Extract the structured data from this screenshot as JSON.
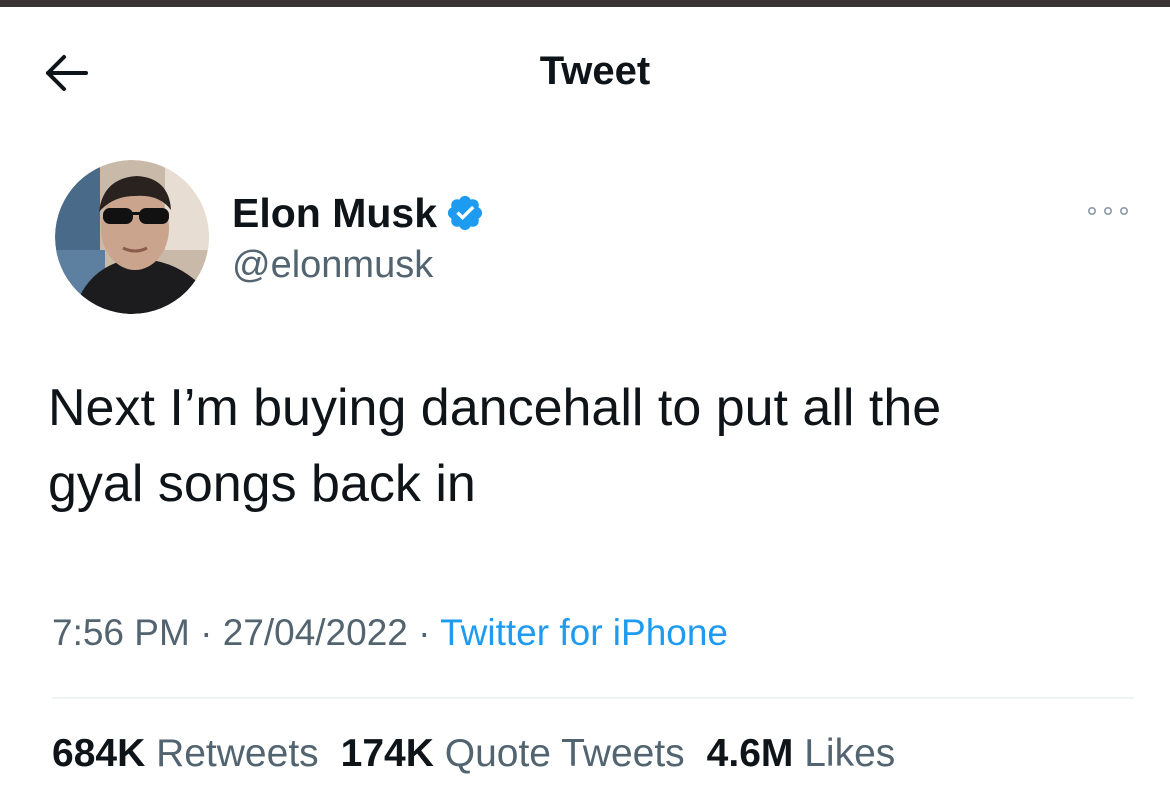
{
  "header": {
    "title": "Tweet",
    "back_icon": "arrow-left-icon"
  },
  "tweet": {
    "author": {
      "name": "Elon Musk",
      "handle": "@elonmusk",
      "verified": true,
      "verified_icon": "verified-badge-icon"
    },
    "more_icon": "more-options-icon",
    "text": "Next I’m buying dancehall to put all the\ngyal songs back in",
    "time": "7:56 PM",
    "date": "27/04/2022",
    "separator": "·",
    "source": "Twitter for iPhone",
    "stats": {
      "retweets_count": "684K",
      "retweets_label": "Retweets",
      "quotes_count": "174K",
      "quotes_label": "Quote Tweets",
      "likes_count": "4.6M",
      "likes_label": "Likes"
    }
  },
  "colors": {
    "text_primary": "#0f1419",
    "text_secondary": "#536471",
    "link": "#1d9bf0",
    "verified": "#1d9bf0",
    "divider": "#eff3f4",
    "top_strip": "#3a3432"
  }
}
